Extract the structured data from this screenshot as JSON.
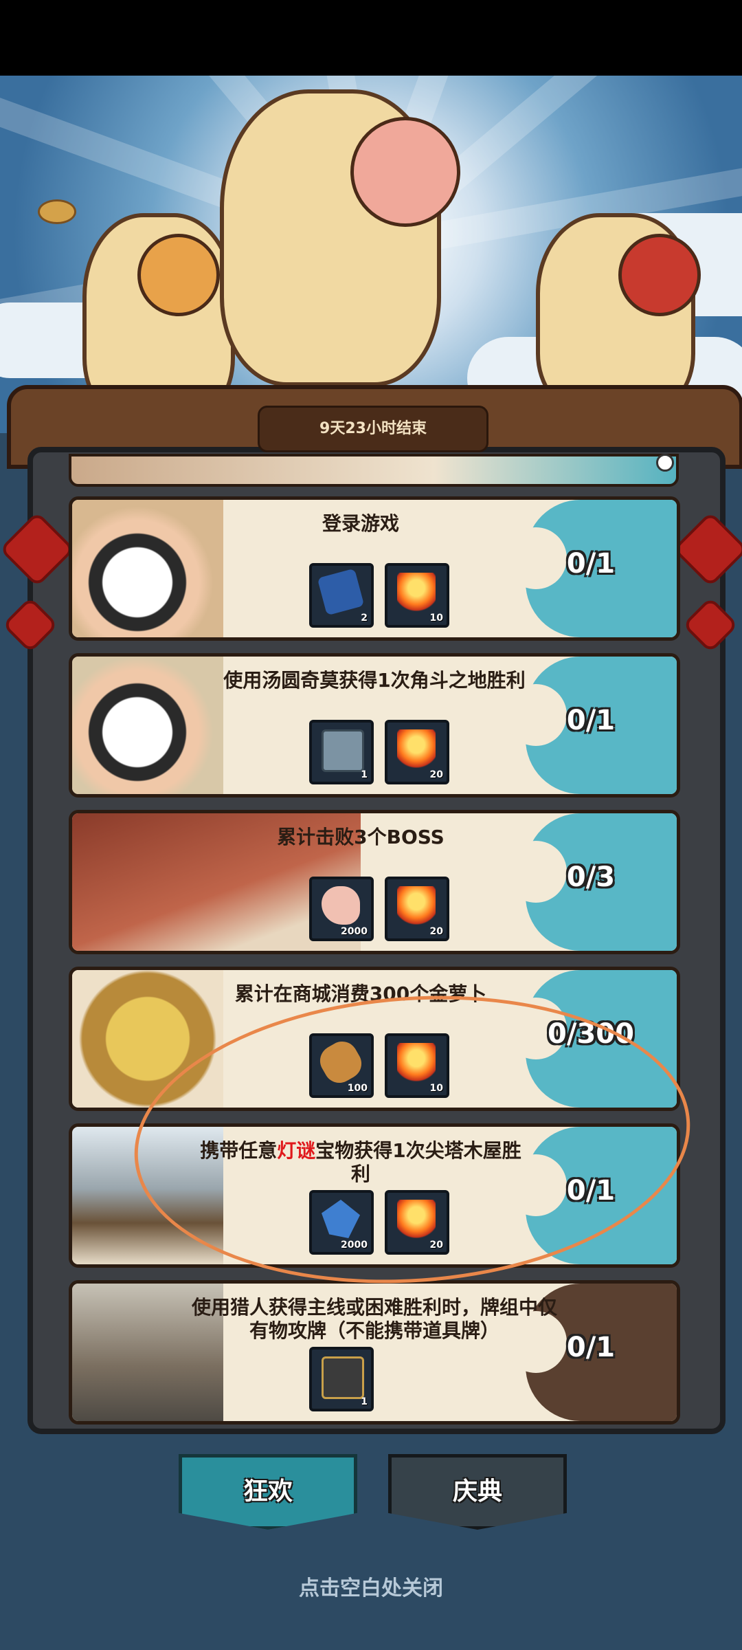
{
  "timer": {
    "label": "9天23小时结束"
  },
  "tasks": [
    {
      "title": "登录游戏",
      "progress": "0/1",
      "rewards": [
        {
          "icon": "ticket-icon",
          "count": "2"
        },
        {
          "icon": "flame-torch-icon",
          "count": "10"
        }
      ]
    },
    {
      "title": "使用汤圆奇莫获得1次角斗之地胜利",
      "progress": "0/1",
      "rewards": [
        {
          "icon": "chest-icon",
          "count": "1"
        },
        {
          "icon": "flame-torch-icon",
          "count": "20"
        }
      ]
    },
    {
      "title": "累计击败3个BOSS",
      "progress": "0/3",
      "rewards": [
        {
          "icon": "meat-icon",
          "count": "2000"
        },
        {
          "icon": "flame-torch-icon",
          "count": "20"
        }
      ]
    },
    {
      "title": "累计在商城消费300个金萝卜",
      "progress": "0/300",
      "rewards": [
        {
          "icon": "bread-icon",
          "count": "100"
        },
        {
          "icon": "flame-torch-icon",
          "count": "10"
        }
      ]
    },
    {
      "title_prefix": "携带任意",
      "title_highlight": "灯谜",
      "title_suffix": "宝物获得1次尖塔木屋胜利",
      "progress": "0/1",
      "rewards": [
        {
          "icon": "crystal-icon",
          "count": "2000"
        },
        {
          "icon": "flame-torch-icon",
          "count": "20"
        }
      ]
    },
    {
      "title": "使用猎人获得主线或困难胜利时，牌组中仅有物攻牌（不能携带道具牌）",
      "progress": "0/1",
      "rewards": [
        {
          "icon": "card-icon",
          "count": "1"
        }
      ]
    }
  ],
  "tabs": [
    {
      "label": "狂欢",
      "active": true
    },
    {
      "label": "庆典",
      "active": false
    }
  ],
  "close_hint": "点击空白处关闭",
  "colors": {
    "accent_teal": "#58b7c6",
    "highlight_red": "#e0191c",
    "frame_wood": "#6b4327"
  }
}
